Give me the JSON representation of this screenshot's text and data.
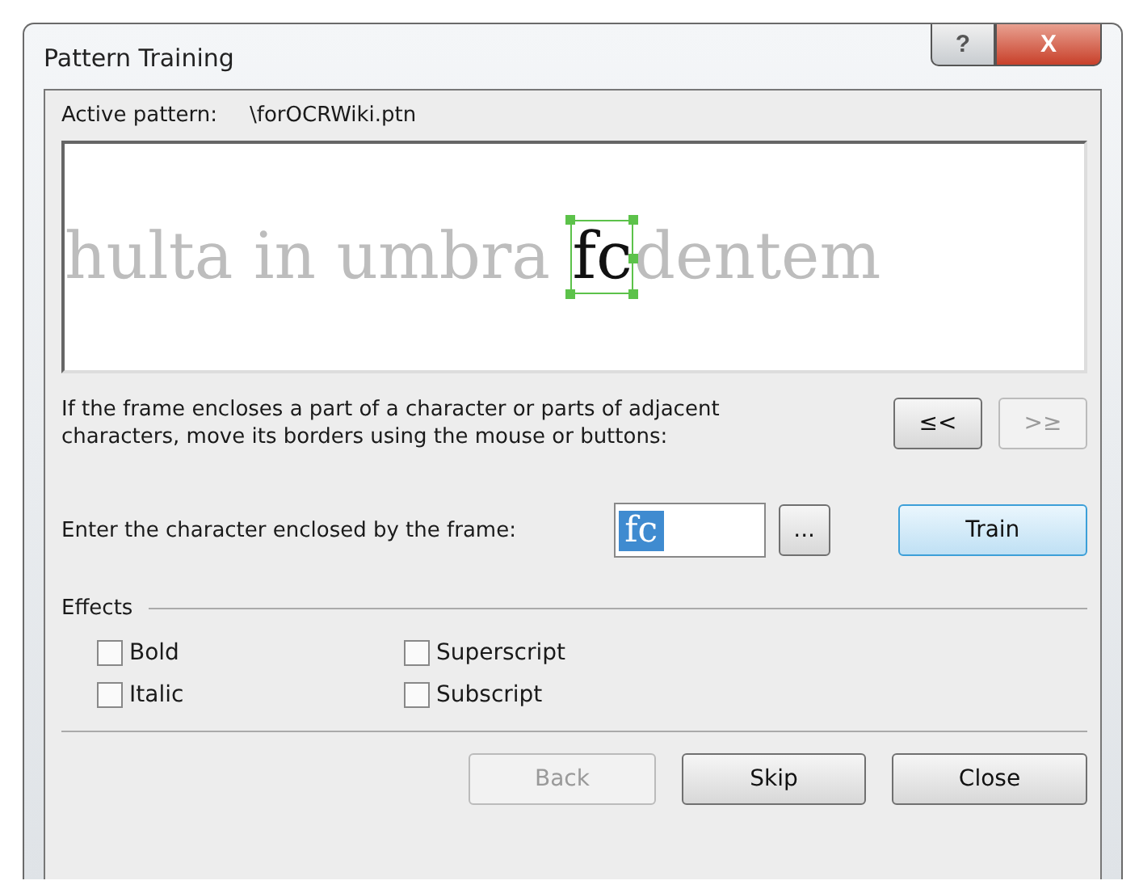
{
  "window": {
    "title": "Pattern Training"
  },
  "title_buttons": [
    {
      "kind": "help",
      "label": "?"
    },
    {
      "kind": "close",
      "label": "X"
    }
  ],
  "active_pattern": {
    "label": "Active pattern:",
    "value": "\\forOCRWiki.ptn"
  },
  "sample": {
    "before": "hulta in umbra ",
    "framed": "fc",
    "after": "dentem"
  },
  "instruction": "If the frame encloses a part of a character or parts of adjacent characters, move its borders using the mouse or buttons:",
  "nav_buttons": [
    {
      "label": "≤<",
      "disabled": false
    },
    {
      "label": ">≥",
      "disabled": true
    }
  ],
  "entry": {
    "label": "Enter the character enclosed by the frame:",
    "value": "fc",
    "more_button": "...",
    "train_button": "Train"
  },
  "effects": {
    "title": "Effects",
    "options": [
      {
        "label": "Bold",
        "checked": false
      },
      {
        "label": "Superscript",
        "checked": false
      },
      {
        "label": "Italic",
        "checked": false
      },
      {
        "label": "Subscript",
        "checked": false
      }
    ]
  },
  "buttons": [
    {
      "label": "Back",
      "disabled": true
    },
    {
      "label": "Skip",
      "disabled": false
    },
    {
      "label": "Close",
      "disabled": false
    }
  ]
}
